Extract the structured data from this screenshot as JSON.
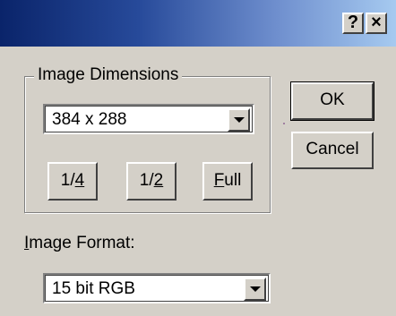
{
  "window": {
    "help_label": "?",
    "close_label": "×"
  },
  "dimensions": {
    "group_title": "Image Dimensions",
    "selected": "384 x 288",
    "quarter_prefix": "1/",
    "quarter_key": "4",
    "half_prefix": "1/",
    "half_key": "2",
    "full_key": "F",
    "full_rest": "ull"
  },
  "format": {
    "label_key": "I",
    "label_rest": "mage Format:",
    "selected": "15 bit RGB"
  },
  "actions": {
    "ok": "OK",
    "cancel": "Cancel"
  },
  "icons": {
    "dropdown": "chevron-down-icon",
    "help": "help-icon",
    "close": "close-icon"
  }
}
